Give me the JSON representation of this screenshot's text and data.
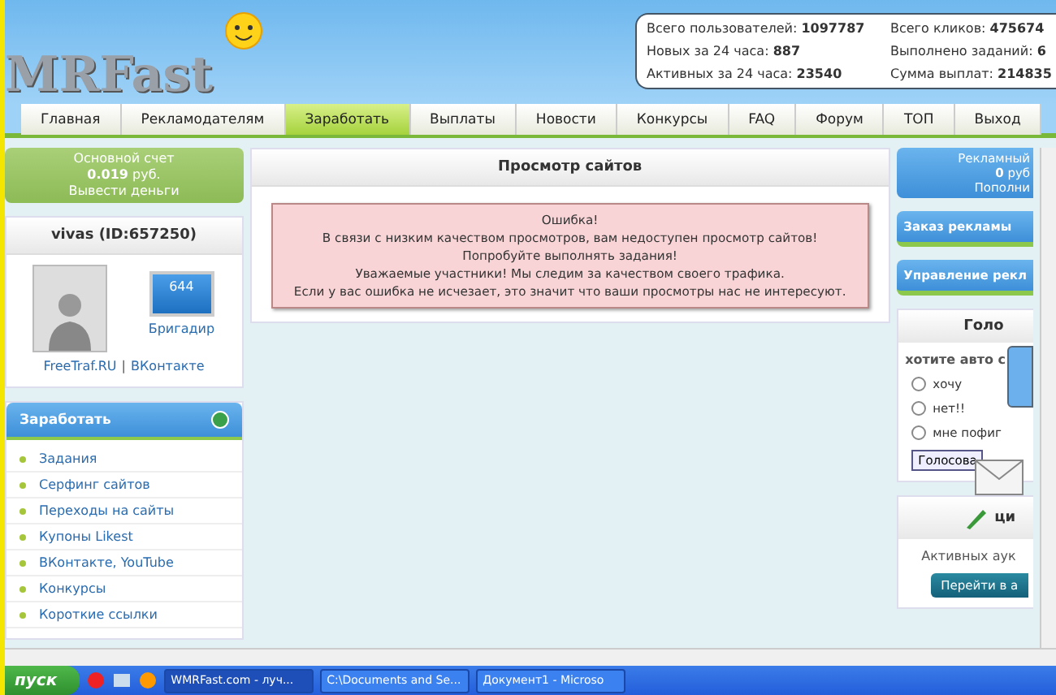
{
  "header": {
    "logo": "MRFast",
    "stats": [
      {
        "label": "Всего пользователей:",
        "value": "1097787"
      },
      {
        "label": "Всего кликов:",
        "value": "475674"
      },
      {
        "label": "Новых за 24 часа:",
        "value": "887"
      },
      {
        "label": "Выполнено заданий:",
        "value": "6"
      },
      {
        "label": "Активных за 24 часа:",
        "value": "23540"
      },
      {
        "label": "Сумма выплат:",
        "value": "214835"
      }
    ]
  },
  "nav": [
    {
      "label": "Главная",
      "selected": false
    },
    {
      "label": "Рекламодателям",
      "selected": false
    },
    {
      "label": "Заработать",
      "selected": true
    },
    {
      "label": "Выплаты",
      "selected": false
    },
    {
      "label": "Новости",
      "selected": false
    },
    {
      "label": "Конкурсы",
      "selected": false
    },
    {
      "label": "FAQ",
      "selected": false
    },
    {
      "label": "Форум",
      "selected": false
    },
    {
      "label": "ТОП",
      "selected": false
    },
    {
      "label": "Выход",
      "selected": false
    }
  ],
  "account": {
    "title": "Основной счет",
    "balance": "0.019",
    "currency": "руб.",
    "action": "Вывести деньги"
  },
  "user": {
    "name": "vivas (ID:657250)",
    "monitor_value": "644",
    "rank": "Бригадир",
    "links": [
      "FreeTraf.RU",
      "ВКонтакте"
    ],
    "separator": "|"
  },
  "earn_menu": {
    "title": "Заработать",
    "items": [
      "Задания",
      "Серфинг сайтов",
      "Переходы на сайты",
      "Купоны Likest",
      "ВКонтакте, YouTube",
      "Конкурсы",
      "Короткие ссылки"
    ]
  },
  "main": {
    "title": "Просмотр сайтов",
    "alert_lines": [
      "Ошибка!",
      "В связи с низким качеством просмотров, вам недоступен просмотр сайтов!",
      "Попробуйте выполнять задания!",
      "Уважаемые участники! Мы следим за качеством своего трафика.",
      "Если у вас ошибка не исчезает, это значит что ваши просмотры нас не интересуют."
    ]
  },
  "right": {
    "ad_account": {
      "title": "Рекламный",
      "balance": "0",
      "currency": "руб",
      "action": "Пополни"
    },
    "links": [
      "Заказ рекламы",
      "Управление рекл"
    ],
    "poll": {
      "title": "Голо",
      "question": "хотите авто с",
      "options": [
        {
          "label": "хочу",
          "selected": false
        },
        {
          "label": "нет!!",
          "selected": false
        },
        {
          "label": "мне пофиг",
          "selected": false
        }
      ],
      "button": "Голосова"
    },
    "auction": {
      "title": "ци",
      "text": "Активных аук",
      "button": "Перейти в а"
    }
  },
  "taskbar": {
    "start": "пуск",
    "windows": [
      {
        "label": "WMRFast.com - луч...",
        "selected": true
      },
      {
        "label": "C:\\Documents and Se...",
        "selected": false
      },
      {
        "label": "Документ1 - Microso",
        "selected": false
      }
    ]
  }
}
